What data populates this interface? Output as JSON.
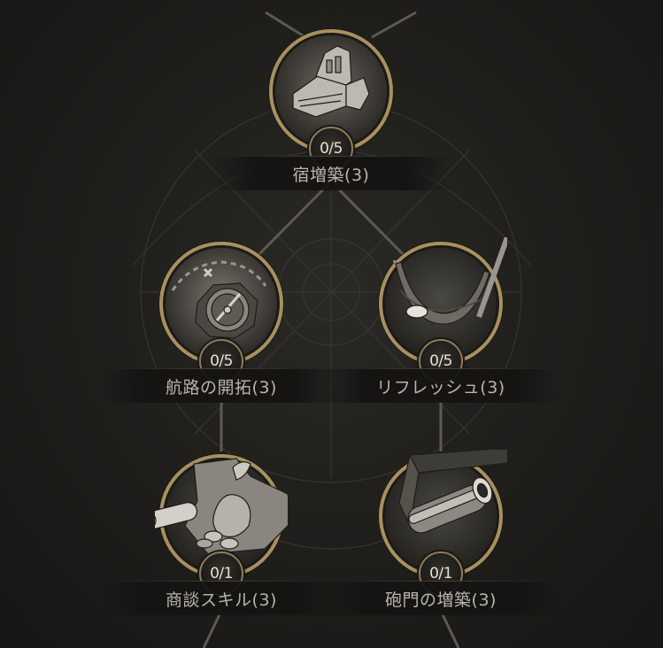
{
  "skill_tree": {
    "nodes": [
      {
        "id": "inn-expansion",
        "icon": "building-icon",
        "progress": "0/5",
        "label": "宿増築(3)"
      },
      {
        "id": "route-pioneering",
        "icon": "compass-map-icon",
        "progress": "0/5",
        "label": "航路の開拓(3)"
      },
      {
        "id": "refresh",
        "icon": "hammock-icon",
        "progress": "0/5",
        "label": "リフレッシュ(3)"
      },
      {
        "id": "negotiation-skill",
        "icon": "scroll-coins-icon",
        "progress": "0/1",
        "label": "商談スキル(3)"
      },
      {
        "id": "gate-expansion",
        "icon": "cannon-icon",
        "progress": "0/1",
        "label": "砲門の増築(3)"
      }
    ]
  },
  "colors": {
    "ring_gold": "#a8905f",
    "ring_dark": "#26231f",
    "label_text": "#b9b4aa",
    "count_text": "#e6e1d6"
  }
}
